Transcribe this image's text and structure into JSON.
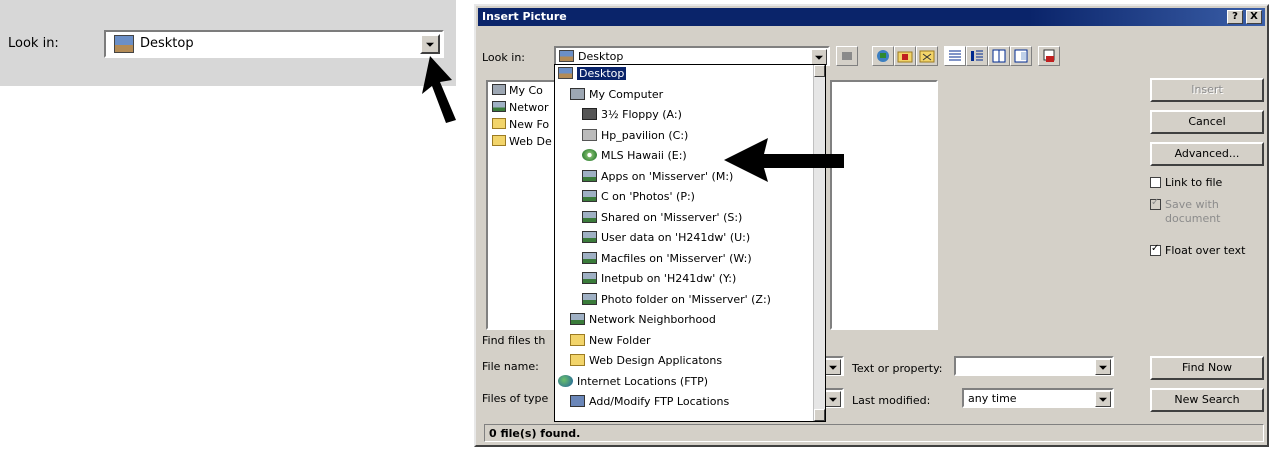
{
  "snippet": {
    "look_in_label": "Look in:",
    "look_in_value": "Desktop"
  },
  "dialog": {
    "title": "Insert Picture",
    "title_buttons": [
      "?",
      "X"
    ],
    "look_in_label": "Look in:",
    "look_in_value": "Desktop",
    "buttons": {
      "insert": "Insert",
      "cancel": "Cancel",
      "advanced": "Advanced...",
      "find_now": "Find Now",
      "new_search": "New Search"
    },
    "checkboxes": {
      "link_to_file": "Link to file",
      "save_with_document_1": "Save with",
      "save_with_document_2": "document",
      "float_over_text": "Float over text"
    },
    "file_list": [
      "My Co",
      "Networ",
      "New Fo",
      "Web De"
    ],
    "find_files_label": "Find files th",
    "file_name_label": "File name:",
    "files_of_type_label": "Files of type",
    "text_or_property_label": "Text or property:",
    "text_or_property_value": "",
    "last_modified_label": "Last modified:",
    "last_modified_value": "any time",
    "status": "0 file(s) found."
  },
  "dropdown": {
    "items": [
      {
        "label": "Desktop",
        "icon": "desktop-icon",
        "indent": 0,
        "selected": true
      },
      {
        "label": "My Computer",
        "icon": "computer-icon",
        "indent": 1
      },
      {
        "label": "3½ Floppy (A:)",
        "icon": "floppy-icon",
        "indent": 2
      },
      {
        "label": "Hp_pavilion (C:)",
        "icon": "drive-icon",
        "indent": 2
      },
      {
        "label": "MLS Hawaii (E:)",
        "icon": "cd-icon",
        "indent": 2
      },
      {
        "label": "Apps on 'Misserver' (M:)",
        "icon": "network-drive-icon",
        "indent": 2
      },
      {
        "label": "C on 'Photos' (P:)",
        "icon": "network-drive-icon",
        "indent": 2
      },
      {
        "label": "Shared on 'Misserver' (S:)",
        "icon": "network-drive-icon",
        "indent": 2
      },
      {
        "label": "User data on 'H241dw' (U:)",
        "icon": "network-drive-icon",
        "indent": 2
      },
      {
        "label": "Macfiles on 'Misserver' (W:)",
        "icon": "network-drive-icon",
        "indent": 2
      },
      {
        "label": "Inetpub on 'H241dw' (Y:)",
        "icon": "network-drive-icon",
        "indent": 2
      },
      {
        "label": "Photo folder on 'Misserver' (Z:)",
        "icon": "network-drive-icon",
        "indent": 2
      },
      {
        "label": "Network Neighborhood",
        "icon": "network-neighborhood-icon",
        "indent": 1
      },
      {
        "label": "New Folder",
        "icon": "folder-icon",
        "indent": 1
      },
      {
        "label": "Web Design Applicatons",
        "icon": "folder-icon",
        "indent": 1
      },
      {
        "label": "Internet Locations (FTP)",
        "icon": "globe-icon",
        "indent": 0
      },
      {
        "label": "Add/Modify FTP Locations",
        "icon": "ftp-icon",
        "indent": 1
      }
    ]
  }
}
